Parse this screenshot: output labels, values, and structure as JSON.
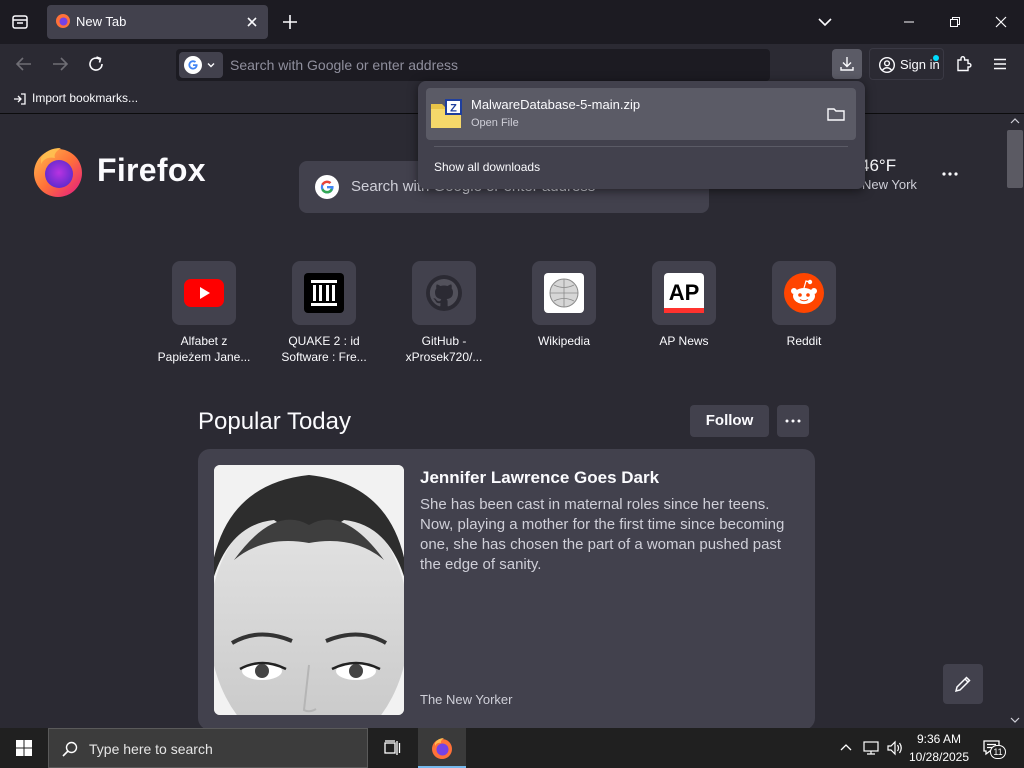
{
  "browser": {
    "tab_title": "New Tab",
    "url_placeholder": "Search with Google or enter address",
    "sign_in_label": "Sign in",
    "import_bookmarks_label": "Import bookmarks..."
  },
  "newtab": {
    "brand_name": "Firefox",
    "search_placeholder": "Search with Google or enter address",
    "weather": {
      "temperature": "46°F",
      "location": "New York"
    },
    "shortcuts": [
      {
        "line1": "Alfabet z",
        "line2": "Papieżem Jane...",
        "icon": "youtube-icon"
      },
      {
        "line1": "QUAKE 2 : id",
        "line2": "Software : Fre...",
        "icon": "internet-archive-icon"
      },
      {
        "line1": "GitHub -",
        "line2": "xProsek720/...",
        "icon": "github-icon"
      },
      {
        "line1": "Wikipedia",
        "line2": "",
        "icon": "wikipedia-icon"
      },
      {
        "line1": "AP News",
        "line2": "",
        "icon": "ap-news-icon"
      },
      {
        "line1": "Reddit",
        "line2": "",
        "icon": "reddit-icon"
      }
    ],
    "popular_title": "Popular Today",
    "follow_label": "Follow",
    "story": {
      "title": "Jennifer Lawrence Goes Dark",
      "excerpt": "She has been cast in maternal roles since her teens. Now, playing a mother for the first time since becoming one, she has chosen the part of a woman pushed past the edge of sanity.",
      "source": "The New Yorker"
    }
  },
  "downloads": {
    "file_name": "MalwareDatabase-5-main.zip",
    "status": "Open File",
    "show_all_label": "Show all downloads"
  },
  "taskbar": {
    "search_placeholder": "Type here to search",
    "time": "9:36 AM",
    "date": "10/28/2025",
    "notification_count": "11"
  },
  "colors": {
    "toolbar": "#2b2a33",
    "tabstrip": "#1c1b22",
    "tile": "#42414d",
    "accent": "#00ddff",
    "firefox_orange": "#ff7139",
    "firefox_purple": "#7542e5"
  }
}
